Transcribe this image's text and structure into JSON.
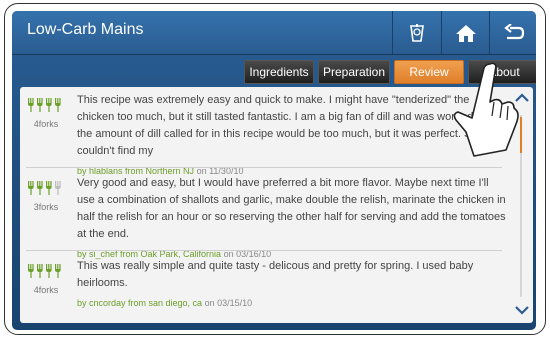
{
  "header": {
    "title": "Low-Carb Mains"
  },
  "tabs": [
    {
      "label": "Ingredients"
    },
    {
      "label": "Preparation"
    },
    {
      "label": "Review"
    },
    {
      "label": "About"
    }
  ],
  "reviews": [
    {
      "rating_label": "4forks",
      "rating": 4,
      "text": "This recipe was extremely easy and quick to make.  I might have \"tenderized\" the chicken too much, but it still tasted fantastic.  I am a big fan of dill and was worried that the amount of dill called for in this recipe would be too much, but it was perfect.  Since I couldn't find my",
      "author": "by hlablans from Northern NJ",
      "date": "on 11/30/10"
    },
    {
      "rating_label": "3forks",
      "rating": 3,
      "text": "Very good and easy, but I would have preferred a bit more flavor. Maybe next time I'll use a combination of shallots and garlic, make double the relish, marinate the chicken in half the relish  for an hour or so reserving the other half for serving and add the tomatoes at the end.",
      "author": "by si_chef from Oak Park, California",
      "date": "on 03/16/10"
    },
    {
      "rating_label": "4forks",
      "rating": 4,
      "text": "This was really simple and quite tasty - delicous and pretty for spring.  I used baby heirlooms.",
      "author": "by cncorday from san diego, ca",
      "date": "on 03/15/10"
    }
  ],
  "colors": {
    "accent": "#e07f2a",
    "header": "#2a5c90",
    "author": "#6c9e2a"
  },
  "icons": {
    "recipe_box": "recipe-box-icon",
    "home": "home-icon",
    "back": "back-icon"
  }
}
